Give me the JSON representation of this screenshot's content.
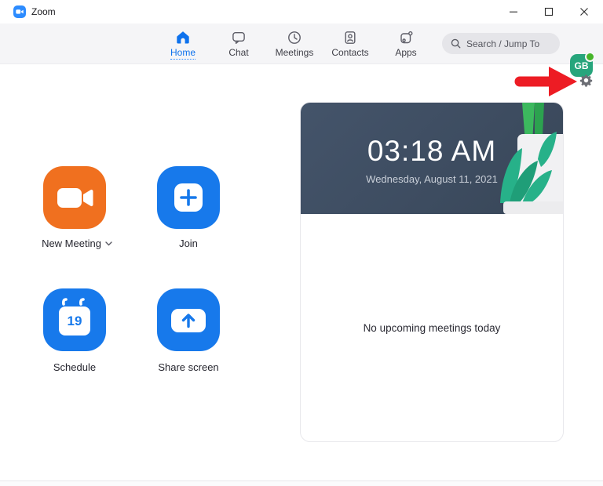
{
  "window": {
    "title": "Zoom"
  },
  "navbar": {
    "tabs": [
      {
        "label": "Home",
        "active": true
      },
      {
        "label": "Chat",
        "active": false
      },
      {
        "label": "Meetings",
        "active": false
      },
      {
        "label": "Contacts",
        "active": false
      },
      {
        "label": "Apps",
        "active": false
      }
    ],
    "search": {
      "placeholder": "Search / Jump To"
    },
    "avatar": {
      "initials": "GB"
    }
  },
  "home": {
    "actions": [
      {
        "label": "New Meeting",
        "icon": "video-camera-icon",
        "color": "#f0701f",
        "has_dropdown": true
      },
      {
        "label": "Join",
        "icon": "plus-icon",
        "color": "#1779eb"
      },
      {
        "label": "Schedule",
        "icon": "calendar-icon",
        "color": "#1779eb",
        "calendar_day": "19"
      },
      {
        "label": "Share screen",
        "icon": "screen-share-icon",
        "color": "#1779eb"
      }
    ]
  },
  "meetings_panel": {
    "time": "03:18 AM",
    "date": "Wednesday, August 11, 2021",
    "empty_message": "No upcoming meetings today"
  },
  "annotation": {
    "arrow_color": "#ed1c24"
  },
  "colors": {
    "accent_blue": "#0E72ED",
    "action_blue": "#1779eb",
    "action_orange": "#f0701f",
    "banner_navy": "#3f4e61",
    "avatar_teal": "#27a57c",
    "online_green": "#46b52a"
  }
}
